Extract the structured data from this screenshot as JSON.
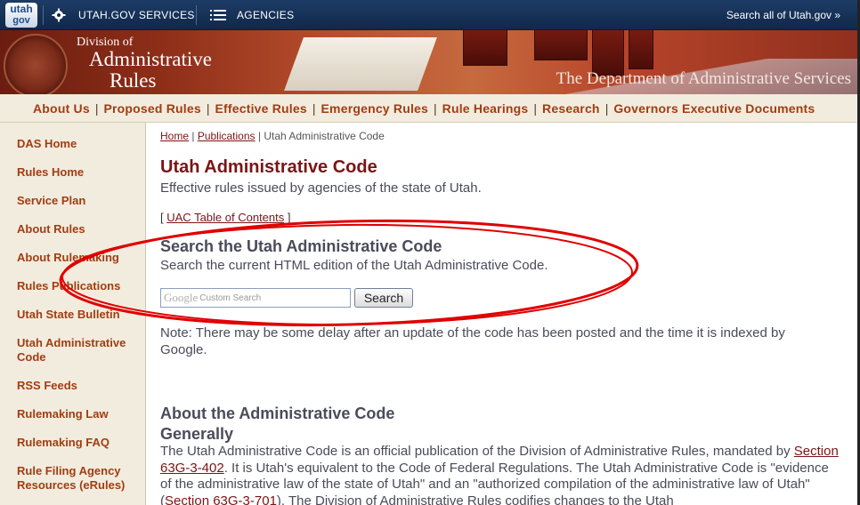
{
  "topbar": {
    "logo_line1": "utah",
    "logo_line2": "gov",
    "services": "UTAH.GOV SERVICES",
    "agencies": "AGENCIES",
    "search": "Search all of Utah.gov »"
  },
  "banner": {
    "title_small": "Division of",
    "title_line1": "Administrative",
    "title_line2": "Rules",
    "department": "The Department of Administrative Services"
  },
  "nav": [
    "About Us",
    "Proposed Rules",
    "Effective Rules",
    "Emergency Rules",
    "Rule Hearings",
    "Research",
    "Governors Executive Documents"
  ],
  "nav_separator": "|",
  "sidebar": [
    "DAS Home",
    "Rules Home",
    "Service Plan",
    "About Rules",
    "About Rulemaking",
    "Rules Publications",
    "Utah State Bulletin",
    "Utah Administrative Code",
    "RSS Feeds",
    "Rulemaking Law",
    "Rulemaking FAQ",
    "Rule Filing Agency Resources (eRules)"
  ],
  "breadcrumb": {
    "home": "Home",
    "sep": "|",
    "publications": "Publications",
    "current": "Utah Administrative Code"
  },
  "main": {
    "title": "Utah Administrative Code",
    "subtitle": "Effective rules issued by agencies of the state of Utah.",
    "toc_open": "[",
    "toc_link": "UAC Table of Contents",
    "toc_close": "]",
    "search_heading": "Search the Utah Administrative Code",
    "search_sub": "Search the current HTML edition of the Utah Administrative Code.",
    "search_logo": "Google",
    "search_placeholder": "Custom Search",
    "search_button": "Search",
    "note": "Note: There may be some delay after an update of the code has been posted and the time it is indexed by Google.",
    "about_heading": "About the Administrative Code",
    "generally_heading": "Generally",
    "para_1": "The Utah Administrative Code is an official publication of the Division of Administrative Rules, mandated by",
    "para_link1": "Section 63G-3-402",
    "para_2": ". It is Utah's equivalent to the Code of Federal Regulations. The Utah Administrative Code is \"evidence of the administrative law of the state of Utah\" and an \"authorized compilation of the administrative law of Utah\" (",
    "para_link2": "Section 63G-3-701",
    "para_3": "). The Division of Administrative Rules codifies changes to the Utah"
  },
  "colors": {
    "nav_link": "#a23d10",
    "heading": "#7a1515",
    "annotation": "#e00000",
    "topbar": "#10284a"
  }
}
